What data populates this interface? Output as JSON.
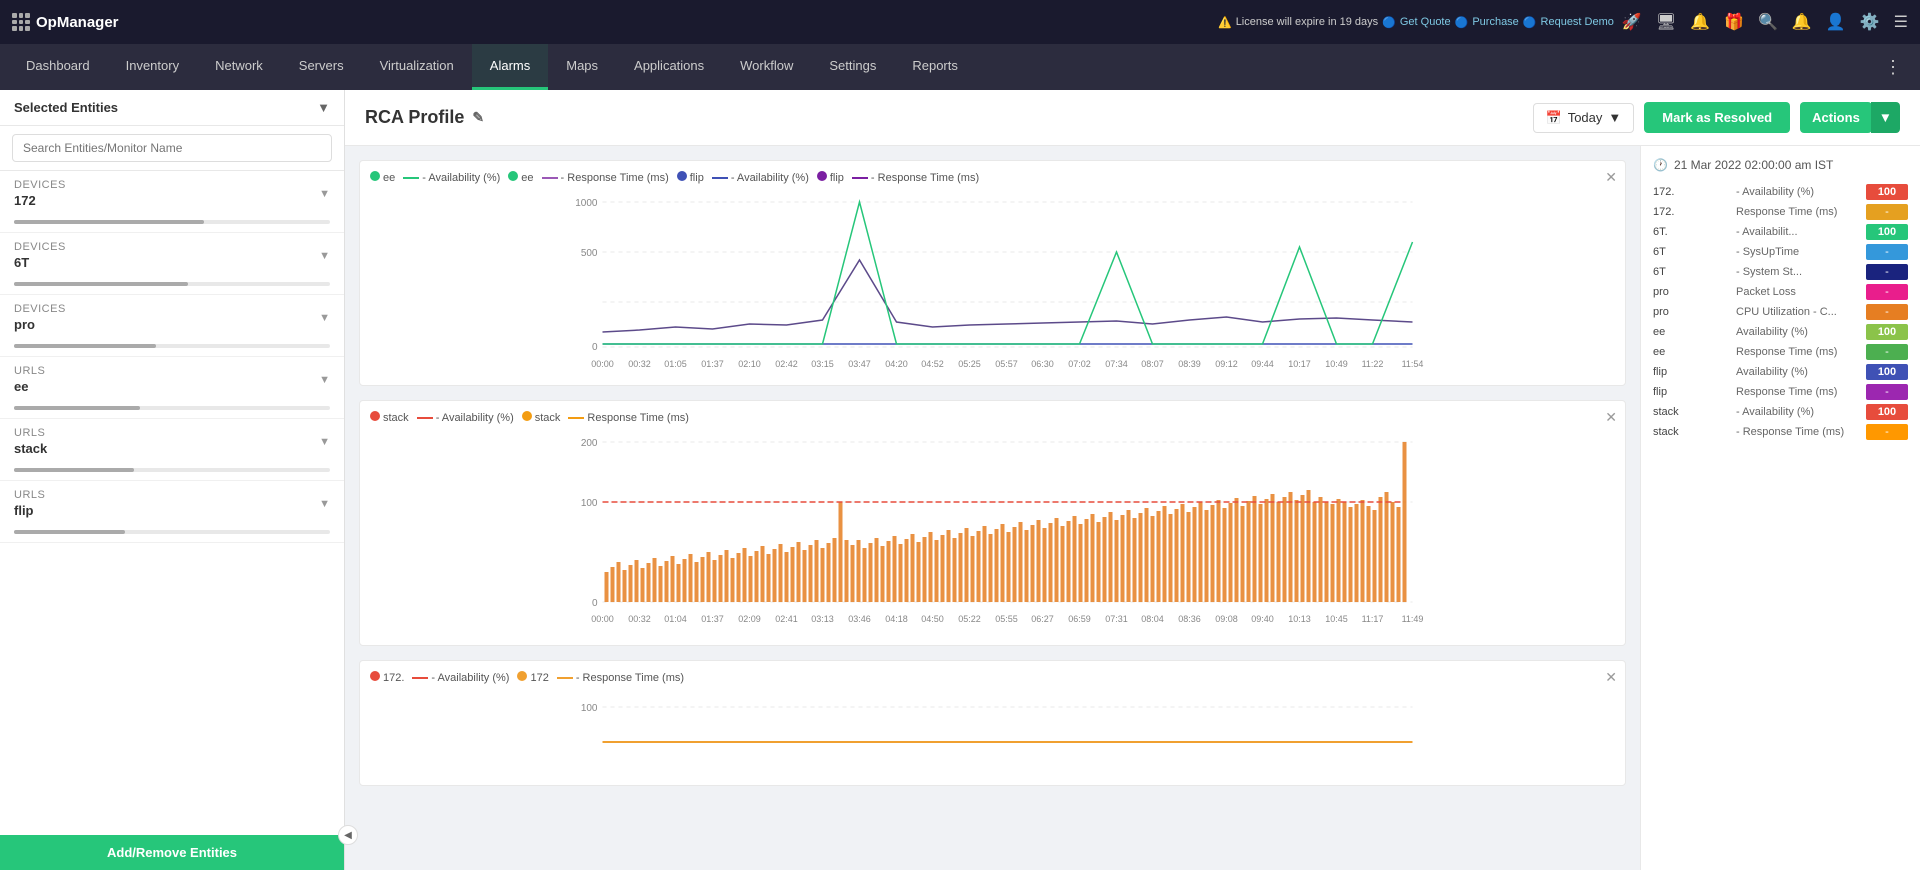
{
  "app": {
    "name": "OpManager",
    "license_text": "License will expire in 19 days",
    "get_quote": "Get Quote",
    "purchase": "Purchase",
    "request_demo": "Request Demo"
  },
  "navbar": {
    "items": [
      {
        "label": "Dashboard",
        "active": false
      },
      {
        "label": "Inventory",
        "active": false
      },
      {
        "label": "Network",
        "active": false
      },
      {
        "label": "Servers",
        "active": false
      },
      {
        "label": "Virtualization",
        "active": false
      },
      {
        "label": "Alarms",
        "active": true
      },
      {
        "label": "Maps",
        "active": false
      },
      {
        "label": "Applications",
        "active": false
      },
      {
        "label": "Workflow",
        "active": false
      },
      {
        "label": "Settings",
        "active": false
      },
      {
        "label": "Reports",
        "active": false
      }
    ]
  },
  "sidebar": {
    "title": "Selected Entities",
    "search_placeholder": "Search Entities/Monitor Name",
    "items": [
      {
        "type": "Devices",
        "name": "172",
        "bar_color": "#888",
        "bar_pct": 60
      },
      {
        "type": "Devices",
        "name": "6T",
        "bar_color": "#888",
        "bar_pct": 55
      },
      {
        "type": "Devices",
        "name": "pro",
        "bar_color": "#888",
        "bar_pct": 45
      },
      {
        "type": "URLs",
        "name": "ee",
        "bar_color": "#888",
        "bar_pct": 40
      },
      {
        "type": "URLs",
        "name": "stack",
        "bar_color": "#888",
        "bar_pct": 38
      },
      {
        "type": "URLs",
        "name": "flip",
        "bar_color": "#888",
        "bar_pct": 35
      }
    ],
    "add_btn": "Add/Remove Entities"
  },
  "content_header": {
    "title": "RCA Profile",
    "date_label": "Today",
    "mark_resolved": "Mark as Resolved",
    "actions": "Actions"
  },
  "right_panel": {
    "datetime": "21 Mar 2022 02:00:00 am IST",
    "metrics": [
      {
        "name": "172.",
        "label": "- Availability (%)",
        "value": "100",
        "color": "#e74c3c",
        "type": "badge"
      },
      {
        "name": "172.",
        "label": "Response Time (ms)",
        "value": "-",
        "color": "#e5a020",
        "type": "dash"
      },
      {
        "name": "6T.",
        "label": "- Availabilit...",
        "value": "100",
        "color": "#26c67a",
        "type": "badge"
      },
      {
        "name": "6T",
        "label": "- SysUpTime",
        "value": "-",
        "color": "#3498db",
        "type": "dash"
      },
      {
        "name": "6T",
        "label": "- System St...",
        "value": "-",
        "color": "#1a237e",
        "type": "dash"
      },
      {
        "name": "pro",
        "label": "Packet Loss",
        "value": "-",
        "color": "#e91e8c",
        "type": "dash"
      },
      {
        "name": "pro",
        "label": "CPU Utilization - C...",
        "value": "-",
        "color": "#e67e22",
        "type": "dash"
      },
      {
        "name": "ee",
        "label": "Availability (%)",
        "value": "100",
        "color": "#8bc34a",
        "type": "badge"
      },
      {
        "name": "ee",
        "label": "Response Time (ms)",
        "value": "-",
        "color": "#4caf50",
        "type": "dash"
      },
      {
        "name": "flip",
        "label": "Availability (%)",
        "value": "100",
        "color": "#3f51b5",
        "type": "badge"
      },
      {
        "name": "flip",
        "label": "Response Time (ms)",
        "value": "-",
        "color": "#9c27b0",
        "type": "dash"
      },
      {
        "name": "stack",
        "label": "- Availability (%)",
        "value": "100",
        "color": "#e74c3c",
        "type": "badge"
      },
      {
        "name": "stack",
        "label": "- Response Time (ms)",
        "value": "-",
        "color": "#ff9800",
        "type": "dash"
      }
    ]
  },
  "chart1": {
    "legend": [
      {
        "dot": "#26c67a",
        "label": "ee"
      },
      {
        "dash": "#26c67a",
        "label": "- Availability (%)"
      },
      {
        "dot": "#26c67a",
        "label": "ee"
      },
      {
        "dash": "#9b59b6",
        "label": "- Response Time (ms)"
      },
      {
        "dot": "#3f51b5",
        "label": "flip"
      },
      {
        "dash": "#3f51b5",
        "label": "- Availability (%)"
      },
      {
        "dot": "#7b1fa2",
        "label": "flip"
      },
      {
        "dash": "#7b1fa2",
        "label": "- Response Time (ms)"
      }
    ],
    "y_labels": [
      "1000",
      "500",
      "0"
    ],
    "x_labels": [
      "00:00",
      "00:32",
      "01:05",
      "01:37",
      "02:10",
      "02:42",
      "03:15",
      "03:47",
      "04:20",
      "04:52",
      "05:25",
      "05:57",
      "06:30",
      "07:02",
      "07:34",
      "08:07",
      "08:39",
      "09:12",
      "09:44",
      "10:17",
      "10:49",
      "11:22",
      "11:54"
    ]
  },
  "chart2": {
    "legend": [
      {
        "dot": "#e67e22",
        "label": "stack"
      },
      {
        "dash": "#e67e22",
        "label": "- Availability (%)"
      },
      {
        "dot": "#f39c12",
        "label": "stack"
      },
      {
        "dash": "#f39c12",
        "label": "Response Time (ms)"
      }
    ],
    "y_labels": [
      "200",
      "100",
      "0"
    ],
    "x_labels": [
      "00:00",
      "00:32",
      "01:04",
      "01:37",
      "02:09",
      "02:41",
      "03:13",
      "03:46",
      "04:18",
      "04:50",
      "05:22",
      "05:55",
      "06:27",
      "06:59",
      "07:31",
      "08:04",
      "08:36",
      "09:08",
      "09:40",
      "10:13",
      "10:45",
      "11:17",
      "11:49"
    ]
  },
  "chart3": {
    "legend": [
      {
        "dot": "#e74c3c",
        "label": "172."
      },
      {
        "dash": "#e74c3c",
        "label": "- Availability (%)"
      },
      {
        "dot": "#e5a020",
        "label": "172"
      },
      {
        "dash": "#e5a020",
        "label": "- Response Time (ms)"
      }
    ],
    "y_labels": [
      "100"
    ],
    "x_labels": []
  }
}
